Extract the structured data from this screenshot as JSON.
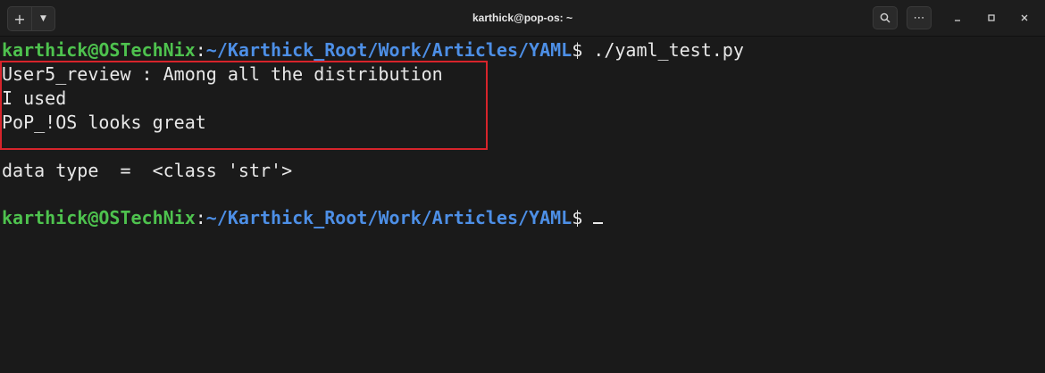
{
  "window": {
    "title": "karthick@pop-os: ~",
    "new_tab_icon": "plus-icon",
    "menu_icon": "chevron-down-icon",
    "search_icon": "search-icon",
    "more_icon": "more-icon",
    "minimize_icon": "minimize-icon",
    "maximize_icon": "maximize-icon",
    "close_icon": "close-icon"
  },
  "terminal": {
    "prompt1": {
      "user": "karthick@OSTechNix",
      "colon": ":",
      "path": "~/Karthick_Root/Work/Articles/YAML",
      "dollar": "$",
      "command": " ./yaml_test.py"
    },
    "output": [
      "User5_review : Among all the distribution",
      "I used",
      "PoP_!OS looks great"
    ],
    "type_line": "data type  =  <class 'str'>",
    "prompt2": {
      "user": "karthick@OSTechNix",
      "colon": ":",
      "path": "~/Karthick_Root/Work/Articles/YAML",
      "dollar": "$"
    }
  },
  "colors": {
    "user": "#4ec24e",
    "path": "#4d8fe6",
    "highlight": "#d7242b",
    "background": "#1a1a1a"
  }
}
